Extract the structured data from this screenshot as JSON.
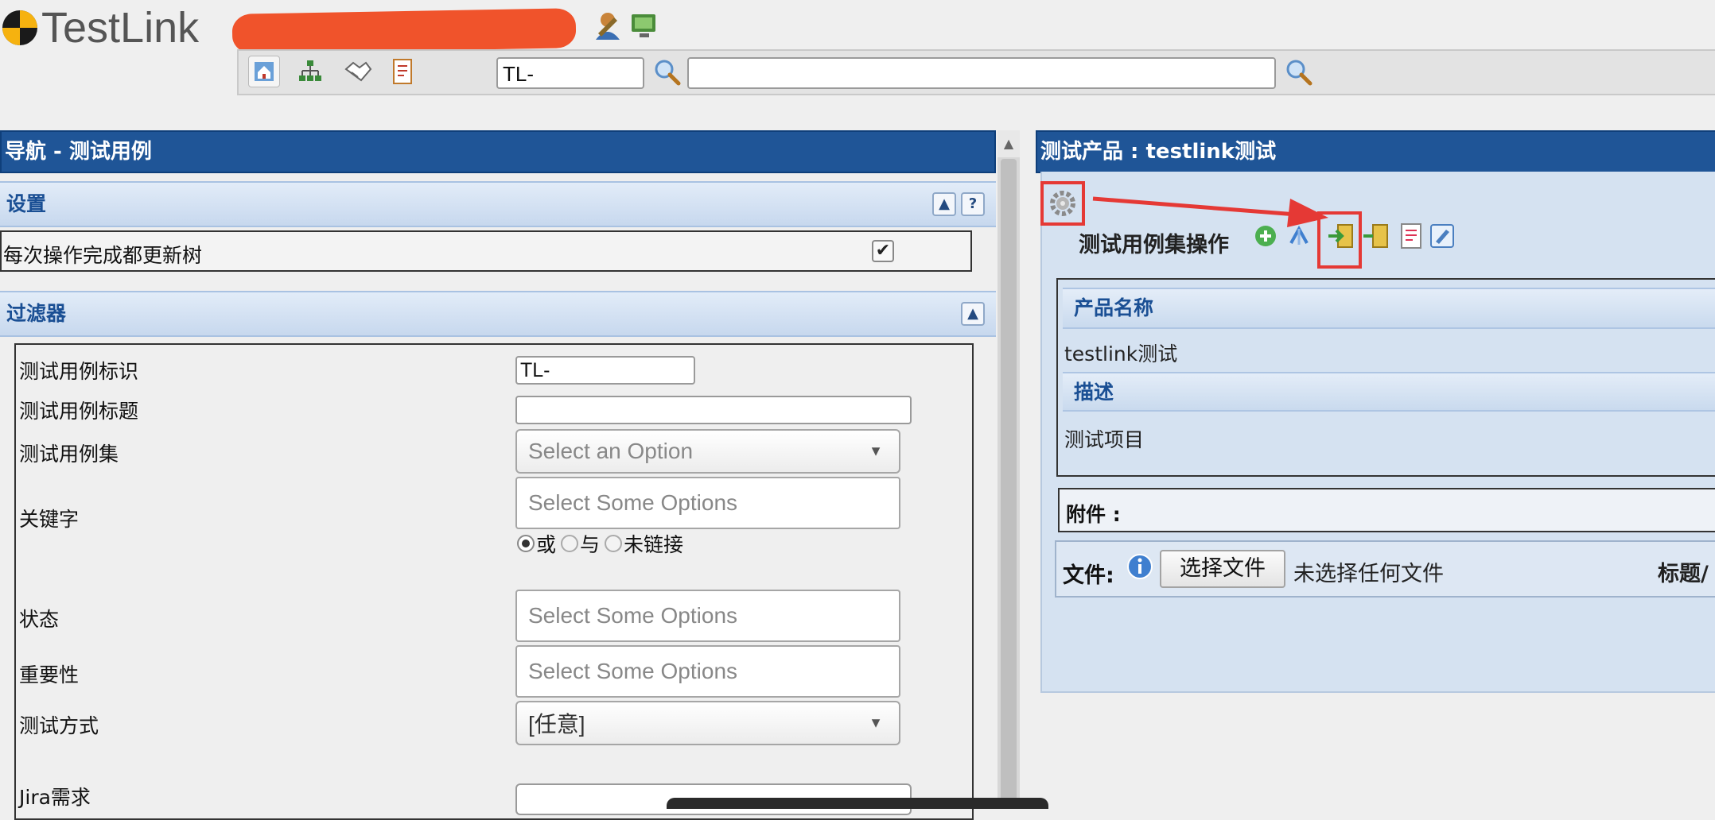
{
  "header": {
    "logo_text": "TestLink"
  },
  "toolbar": {
    "tc_id_value": "TL-",
    "search_value": ""
  },
  "left_panel": {
    "title": "导航 - 测试用例",
    "settings": {
      "title": "设置",
      "refresh_label": "每次操作完成都更新树",
      "refresh_checked": true,
      "help_label": "?",
      "collapse_label": "▲"
    },
    "filters": {
      "title": "过滤器",
      "collapse_label": "▲",
      "tc_id_label": "测试用例标识",
      "tc_id_value": "TL-",
      "tc_title_label": "测试用例标题",
      "tc_title_value": "",
      "suite_label": "测试用例集",
      "suite_placeholder": "Select an Option",
      "keyword_label": "关键字",
      "keyword_placeholder": "Select Some Options",
      "keyword_mode": [
        "或",
        "与",
        "未链接"
      ],
      "status_label": "状态",
      "status_placeholder": "Select Some Options",
      "importance_label": "重要性",
      "importance_placeholder": "Select Some Options",
      "exec_type_label": "测试方式",
      "exec_type_value": "[任意]",
      "jira_label": "Jira需求"
    }
  },
  "right_panel": {
    "title": "测试产品 : testlink测试",
    "actions_label": "测试用例集操作",
    "product_name_header": "产品名称",
    "product_name": "testlink测试",
    "description_header": "描述",
    "description": "测试项目",
    "attachments_label": "附件 :",
    "file_label": "文件:",
    "choose_file_button": "选择文件",
    "no_file_text": "未选择任何文件",
    "title_label": "标题/"
  },
  "colors": {
    "panel_header": "#1f5597",
    "section_header_text": "#1a4f94",
    "redaction": "#f0532b",
    "annotation_red": "#e53935"
  },
  "icons": [
    "logo-icon",
    "user-icon",
    "monitor-icon",
    "home-icon",
    "tree-icon",
    "handshake-icon",
    "report-icon",
    "search-icon",
    "gear-icon",
    "add-icon",
    "move-icon",
    "import-icon",
    "export-icon",
    "document-icon",
    "edit-icon",
    "info-icon"
  ]
}
